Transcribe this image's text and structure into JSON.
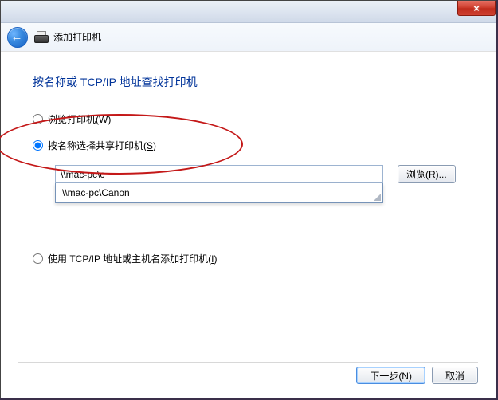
{
  "header": {
    "title": "添加打印机"
  },
  "page": {
    "heading": "按名称或 TCP/IP 地址查找打印机"
  },
  "options": {
    "browse": {
      "label": "浏览打印机(",
      "key": "W",
      "suffix": ")"
    },
    "select": {
      "label": "按名称选择共享打印机(",
      "key": "S",
      "suffix": ")"
    },
    "ip": {
      "label": "使用 TCP/IP 地址或主机名添加打印机(",
      "key": "I",
      "suffix": ")"
    }
  },
  "input": {
    "value": "\\\\mac-pc\\c"
  },
  "dropdown": {
    "items": [
      "\\\\mac-pc\\Canon"
    ]
  },
  "buttons": {
    "browse": "浏览(R)...",
    "next": "下一步(N)",
    "cancel": "取消"
  },
  "selected_option": "select"
}
